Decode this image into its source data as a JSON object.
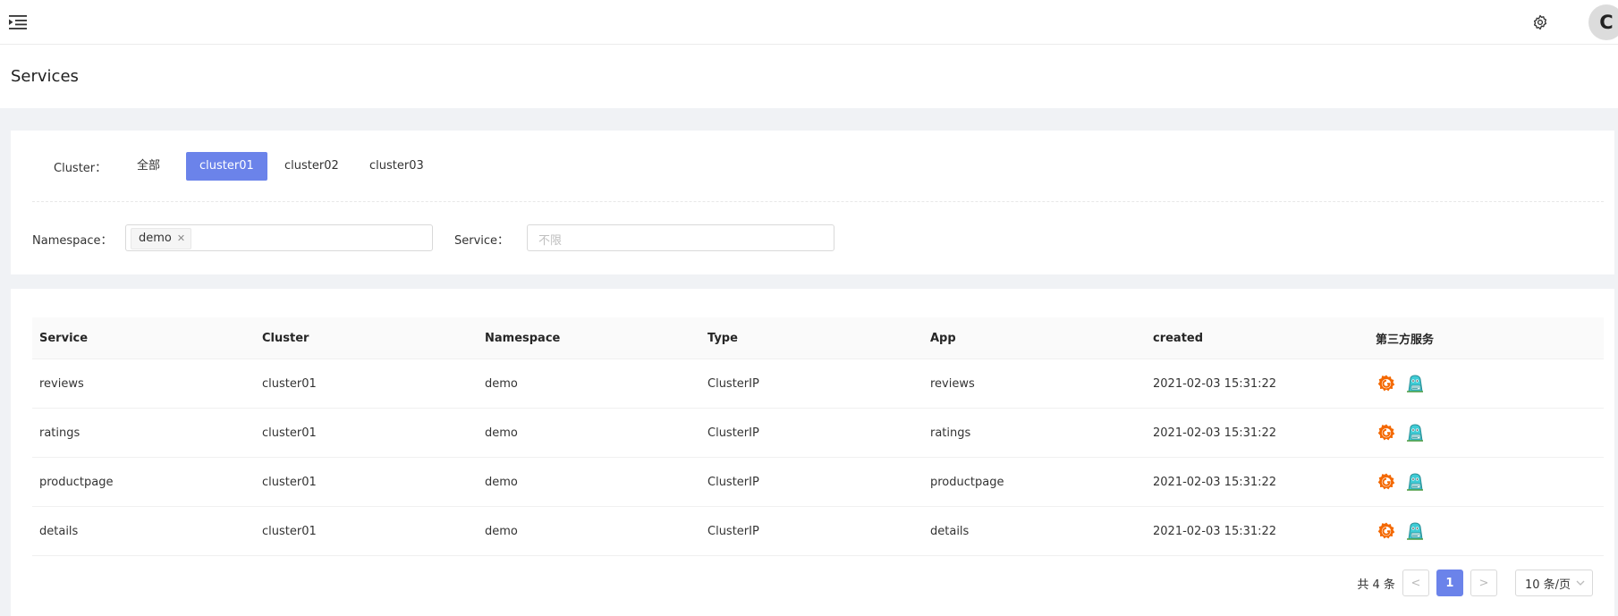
{
  "page": {
    "title": "Services"
  },
  "filters": {
    "cluster_label": "Cluster：",
    "clusters": [
      "全部",
      "cluster01",
      "cluster02",
      "cluster03"
    ],
    "selected_cluster": "cluster01",
    "namespace_label": "Namespace：",
    "namespace_tags": [
      "demo"
    ],
    "service_label": "Service：",
    "service_placeholder": "不限"
  },
  "table": {
    "columns": [
      "Service",
      "Cluster",
      "Namespace",
      "Type",
      "App",
      "created",
      "第三方服务"
    ],
    "rows": [
      {
        "service": "reviews",
        "cluster": "cluster01",
        "namespace": "demo",
        "type": "ClusterIP",
        "app": "reviews",
        "created": "2021-02-03 15:31:22"
      },
      {
        "service": "ratings",
        "cluster": "cluster01",
        "namespace": "demo",
        "type": "ClusterIP",
        "app": "ratings",
        "created": "2021-02-03 15:31:22"
      },
      {
        "service": "productpage",
        "cluster": "cluster01",
        "namespace": "demo",
        "type": "ClusterIP",
        "app": "productpage",
        "created": "2021-02-03 15:31:22"
      },
      {
        "service": "details",
        "cluster": "cluster01",
        "namespace": "demo",
        "type": "ClusterIP",
        "app": "details",
        "created": "2021-02-03 15:31:22"
      }
    ],
    "row_icons": [
      "grafana-icon",
      "kiali-icon"
    ]
  },
  "pagination": {
    "total_text": "共 4 条",
    "prev": "<",
    "current": "1",
    "next": ">",
    "page_size": "10 条/页"
  },
  "user": {
    "avatar_letter": "C"
  },
  "colors": {
    "accent": "#6b83ea",
    "grafana": "#f46800",
    "kiali": "#3ecbd5"
  }
}
